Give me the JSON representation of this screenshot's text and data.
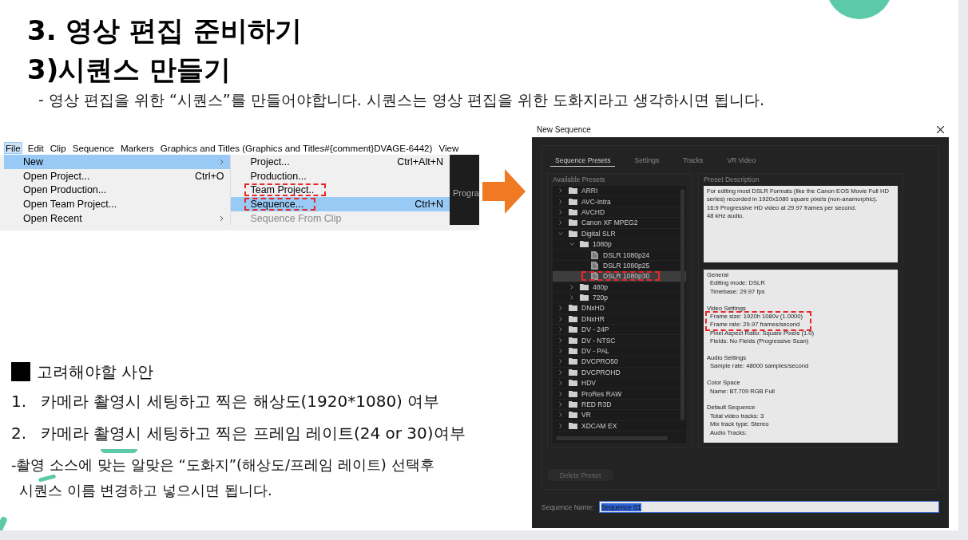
{
  "slide": {
    "title": "3. 영상 편집 준비하기",
    "subtitle": "3)시퀀스 만들기",
    "description": "- 영상 편집을 위한 “시퀀스”를 만들어야합니다. 시퀀스는 영상 편집을 위한 도화지라고 생각하시면 됩니다."
  },
  "menu_screenshot": {
    "menubar": [
      "File",
      "Edit",
      "Clip",
      "Sequence",
      "Markers",
      "Graphics and Titles (Graphics and Titles#{comment}DVAGE-6442)",
      "View"
    ],
    "file_menu": [
      {
        "label": "New",
        "submenu": true,
        "selected": true
      },
      {
        "label": "Open Project...",
        "shortcut": "Ctrl+O",
        "submenu": false,
        "selected": false
      },
      {
        "label": "Open Production...",
        "submenu": false,
        "selected": false
      },
      {
        "label": "Open Team Project...",
        "submenu": false,
        "selected": false
      },
      {
        "label": "Open Recent",
        "submenu": true,
        "selected": false
      }
    ],
    "new_submenu": [
      {
        "label": "Project...",
        "shortcut": "Ctrl+Alt+N",
        "selected": false,
        "disabled": false,
        "highlighted": false
      },
      {
        "label": "Production...",
        "selected": false,
        "disabled": false,
        "highlighted": false
      },
      {
        "label": "Team Project..",
        "selected": false,
        "disabled": false,
        "highlighted": true
      },
      {
        "label": "Sequence...",
        "shortcut": "Ctrl+N",
        "selected": true,
        "disabled": false,
        "highlighted": true
      },
      {
        "label": "Sequence From Clip",
        "selected": false,
        "disabled": true,
        "highlighted": false
      }
    ],
    "side_panel_label": "Progra"
  },
  "dialog": {
    "title": "New Sequence",
    "tabs": [
      {
        "label": "Sequence Presets",
        "selected": true
      },
      {
        "label": "Settings",
        "selected": false
      },
      {
        "label": "Tracks",
        "selected": false
      },
      {
        "label": "VR Video",
        "selected": false
      }
    ],
    "presets_label": "Available Presets",
    "presets": [
      {
        "kind": "folder",
        "label": "ARRI",
        "expanded": false,
        "selected": false,
        "highlighted": false
      },
      {
        "kind": "folder",
        "label": "AVC-Intra",
        "expanded": false,
        "selected": false,
        "highlighted": false
      },
      {
        "kind": "folder",
        "label": "AVCHD",
        "expanded": false,
        "selected": false,
        "highlighted": false
      },
      {
        "kind": "folder",
        "label": "Canon XF MPEG2",
        "expanded": false,
        "selected": false,
        "highlighted": false
      },
      {
        "kind": "folder",
        "label": "Digital SLR",
        "expanded": true,
        "selected": false,
        "highlighted": false,
        "children": [
          {
            "kind": "folder",
            "label": "1080p",
            "expanded": true,
            "selected": false,
            "highlighted": false,
            "children": [
              {
                "kind": "preset",
                "label": "DSLR 1080p24",
                "selected": false,
                "highlighted": false
              },
              {
                "kind": "preset",
                "label": "DSLR 1080p25",
                "selected": false,
                "highlighted": false
              },
              {
                "kind": "preset",
                "label": "DSLR 1080p30",
                "selected": true,
                "highlighted": true
              }
            ]
          },
          {
            "kind": "folder",
            "label": "480p",
            "expanded": false,
            "selected": false,
            "highlighted": false
          },
          {
            "kind": "folder",
            "label": "720p",
            "expanded": false,
            "selected": false,
            "highlighted": false
          }
        ]
      },
      {
        "kind": "folder",
        "label": "DNxHD",
        "expanded": false,
        "selected": false,
        "highlighted": false
      },
      {
        "kind": "folder",
        "label": "DNxHR",
        "expanded": false,
        "selected": false,
        "highlighted": false
      },
      {
        "kind": "folder",
        "label": "DV - 24P",
        "expanded": false,
        "selected": false,
        "highlighted": false
      },
      {
        "kind": "folder",
        "label": "DV - NTSC",
        "expanded": false,
        "selected": false,
        "highlighted": false
      },
      {
        "kind": "folder",
        "label": "DV - PAL",
        "expanded": false,
        "selected": false,
        "highlighted": false
      },
      {
        "kind": "folder",
        "label": "DVCPRO50",
        "expanded": false,
        "selected": false,
        "highlighted": false
      },
      {
        "kind": "folder",
        "label": "DVCPROHD",
        "expanded": false,
        "selected": false,
        "highlighted": false
      },
      {
        "kind": "folder",
        "label": "HDV",
        "expanded": false,
        "selected": false,
        "highlighted": false
      },
      {
        "kind": "folder",
        "label": "ProRes RAW",
        "expanded": false,
        "selected": false,
        "highlighted": false
      },
      {
        "kind": "folder",
        "label": "RED R3D",
        "expanded": false,
        "selected": false,
        "highlighted": false
      },
      {
        "kind": "folder",
        "label": "VR",
        "expanded": false,
        "selected": false,
        "highlighted": false
      },
      {
        "kind": "folder",
        "label": "XDCAM EX",
        "expanded": false,
        "selected": false,
        "highlighted": false
      }
    ],
    "description_label": "Preset Description",
    "description": "For editing most DSLR Formats (like the Canon EOS Movie Full HD series) recorded in 1920x1080 square pixels (non-anamorphic).\n16:9 Progressive HD video at 29.97 frames per second.\n48 kHz audio.",
    "details": [
      {
        "heading": "General",
        "lines": [
          {
            "text": "Editing mode: DSLR",
            "highlighted": false
          },
          {
            "text": "Timebase: 29.97 fps",
            "highlighted": false
          }
        ]
      },
      {
        "heading": "Video Settings",
        "lines": [
          {
            "text": "Frame size: 1920h 1080v (1.0000)",
            "highlighted": true
          },
          {
            "text": "Frame rate: 29.97  frames/second",
            "highlighted": true
          },
          {
            "text": "Pixel Aspect Ratio: Square Pixels (1.0)",
            "highlighted": false
          },
          {
            "text": "Fields: No Fields (Progressive Scan)",
            "highlighted": false
          }
        ]
      },
      {
        "heading": "Audio Settings",
        "lines": [
          {
            "text": "Sample rate: 48000 samples/second",
            "highlighted": false
          }
        ]
      },
      {
        "heading": "Color Space",
        "lines": [
          {
            "text": "Name: BT.709 RGB Full",
            "highlighted": false
          }
        ]
      },
      {
        "heading": "Default Sequence",
        "lines": [
          {
            "text": "Total video tracks: 3",
            "highlighted": false
          },
          {
            "text": "Mix track type: Stereo",
            "highlighted": false
          },
          {
            "text": "Audio Tracks:",
            "highlighted": false
          }
        ]
      }
    ],
    "delete_button": {
      "label": "Delete Preset",
      "disabled": true
    },
    "sequence_name": {
      "label": "Sequence Name:",
      "value": "Sequence 01"
    }
  },
  "notes": {
    "heading": "고려해야할 사안",
    "items": [
      {
        "number": "1.",
        "text": "카메라 촬영시 세팅하고 찍은 해상도(1920*1080) 여부"
      },
      {
        "number": "2.",
        "text": "카메라 촬영시 세팅하고 찍은 프레임 레이트(24 or 30)여부"
      }
    ],
    "paragraph": [
      "-촬영 소스에 맞는 알맞은 “도화지”(해상도/프레임 레이트) 선택후",
      "시퀀스 이름 변경하고 넣으시면 됩니다."
    ]
  }
}
